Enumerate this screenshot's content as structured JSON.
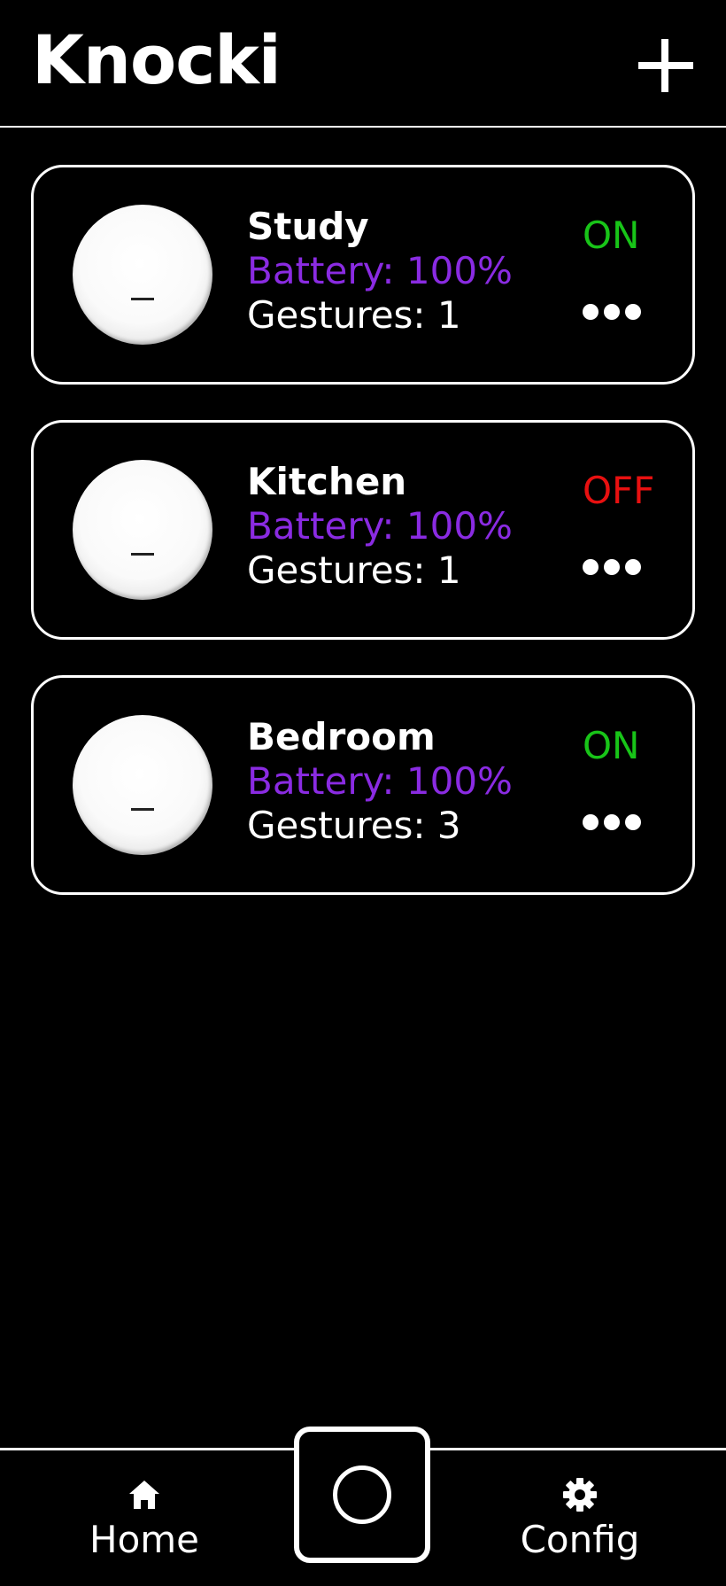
{
  "header": {
    "title": "Knocki",
    "add_icon": "plus-icon"
  },
  "devices": [
    {
      "name": "Study",
      "battery": "Battery: 100%",
      "gestures": "Gestures: 1",
      "status": "ON",
      "status_color": "#18c418",
      "knob_mark": "_"
    },
    {
      "name": "Kitchen",
      "battery": "Battery: 100%",
      "gestures": "Gestures: 1",
      "status": "OFF",
      "status_color": "#e81010",
      "knob_mark": "_"
    },
    {
      "name": "Bedroom",
      "battery": "Battery: 100%",
      "gestures": "Gestures: 3",
      "status": "ON",
      "status_color": "#18c418",
      "knob_mark": "_"
    }
  ],
  "nav": {
    "home_label": "Home",
    "home_icon": "home-icon",
    "config_label": "Config",
    "config_icon": "gear-icon",
    "center_icon": "circle-icon"
  },
  "colors": {
    "background": "#000000",
    "foreground": "#ffffff",
    "battery": "#8a2be2",
    "on": "#18c418",
    "off": "#e81010"
  }
}
